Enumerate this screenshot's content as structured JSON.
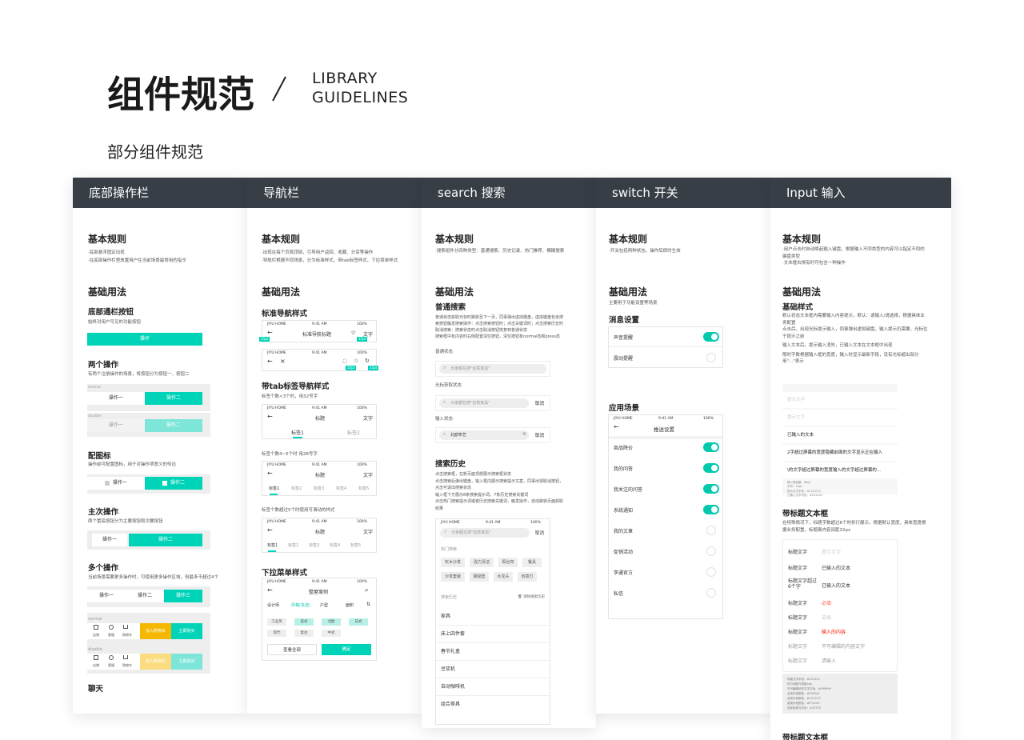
{
  "header": {
    "title": "组件规范",
    "lib1": "LIBRARY",
    "lib2": "GUIDELINES",
    "subtitle": "部分组件规范"
  },
  "p1": {
    "head": "底部操作栏",
    "rules": "基本规则",
    "r1": "·底部悬浮固定出现",
    "r2": "·在底部操作栏里放置用户在当前场景最常用的指令",
    "usage": "基础用法",
    "s1": "底部通栏按钮",
    "s1d": "始终对用户可见的功能按钮",
    "s1b": "操作",
    "s2": "两个操作",
    "s2d": "有两个注册操作的场景，将按钮分为按钮一、按钮二",
    "normal": "normal",
    "disable": "disable",
    "op1": "操作一",
    "op2": "操作二",
    "op3": "操作三",
    "s3": "配图标",
    "s3d": "操作前可配置图标，用于对操作项意义的传达",
    "s4": "主次操作",
    "s4d": "两个置底按钮分为主要按钮和次要按钮",
    "s5": "多个操作",
    "s5d": "当前场景需要更多操作时，可使用更多操作区域，但最多不超过4个",
    "ic1": "店铺",
    "ic2": "客服",
    "ic3": "购物车",
    "cart": "加入购物车",
    "buy": "立即购买",
    "chat": "聊天"
  },
  "p2": {
    "head": "导航栏",
    "rules": "基本规则",
    "r1": "·出现在每个页面顶部，引导用户返回、收藏、分享等操作",
    "r2": "·导航栏根据不同场景，分为标准样式、带tab标签样式、下拉菜单样式",
    "usage": "基础用法",
    "s1": "标准导航样式",
    "carrier": "JIYU HOME",
    "time": "9:41 AM",
    "batt": "100%",
    "navtitle": "标准导航标题",
    "text": "文字",
    "t15": "15pt",
    "s2": "带tab标签导航样式",
    "s2d": "标签个数<3个时，用32号字",
    "title": "标题",
    "tag1": "标签1",
    "tag2": "标签2",
    "tag3": "标签3",
    "tag4": "标签4",
    "tag5": "标签5",
    "s2e": "标签个数4~5个时 用28号字",
    "s2f": "标签个数超过5个时使用可滑动的样式",
    "s3": "下拉菜单样式",
    "cases": "整屋案例",
    "f1": "设计师",
    "f2": "风格(多选)",
    "f3": "户型",
    "f4": "面积",
    "o1": "工业风",
    "o2": "美式",
    "o3": "北欧",
    "o4": "日式",
    "o5": "现代",
    "o6": "复古",
    "o7": "中式",
    "all": "查看全部",
    "ok": "确定"
  },
  "p3": {
    "head": "search 搜索",
    "rules": "基本规则",
    "r1": "·搜索组件分四种类型：普通搜索、历史记录、热门推荐、模糊搜索",
    "usage": "基础用法",
    "s1": "普通搜索",
    "d1": "普通状态获取光标时跳转至下一页，同事弹出虚拟键盘，虚拟键盘包含搜",
    "d2": "索按钮触发搜索操作：点击搜索按钮时；点击关键词时；点击搜索历史时",
    "d3": "取消搜索：搜索状态时点击取消按钮恢复到普通状态",
    "d4": "搜索框中有内容时右侧配置清空按钮，清空按钮有normal态和press态",
    "st1": "普通状态",
    "ph": "大家都在搜\"创意家具\"",
    "st2": "光标获取状态",
    "cancel": "取消",
    "st3": "输入状态",
    "input": "北欧布艺",
    "s2": "搜索历史",
    "e1": "点击搜索框，在新页面顶部展示搜索框状态",
    "e2": "点击搜索后弹出键盘，输入框内展示搜索提示文案，同事出现取消按钮，",
    "e3": "点击可退出搜索状态",
    "e4": "输入框下方展示8条搜索提示词，7条历史搜索关键词",
    "e5": "点击热门搜索提示词或者历史搜索关键词，触发操作，自动跳转页面获取",
    "e6": "结果",
    "carrier": "JIYU HOME",
    "time": "9:41 AM",
    "batt": "100%",
    "hot": "热门搜索",
    "h1": "实木沙发",
    "h2": "强力清洁",
    "h3": "阳台帘",
    "h4": "餐具",
    "h5": "沙发套装",
    "h6": "飘窗垫",
    "h7": "水龙头",
    "h8": "创意灯",
    "hist": "搜索历史",
    "clear": "清除搜索历史",
    "l1": "家具",
    "l2": "床上四件套",
    "l3": "春节礼盒",
    "l4": "豆浆机",
    "l5": "自动咖啡机",
    "l6": "组合茶具"
  },
  "p4": {
    "head": "switch 开关",
    "rules": "基本规则",
    "r1": "·开关包括两种状态，操作后即时生效",
    "usage": "基础用法",
    "ud": "主要用于功能设置等场景",
    "s1": "消息设置",
    "m1": "声音提醒",
    "m2": "震动提醒",
    "s2": "应用场景",
    "carrier": "JIYU HOME",
    "time": "9:41 AM",
    "batt": "100%",
    "ptitle": "推送设置",
    "i1": "商品降价",
    "i2": "我的问答",
    "i3": "我关注的问答",
    "i4": "系统通知",
    "i5": "我的文章",
    "i6": "促销活动",
    "i7": "李通官方",
    "i8": "私信"
  },
  "p5": {
    "head": "Input 输入",
    "rules": "基本规则",
    "r1": "·用户点击时自动唤起输入键盘，根据输入不同类型的内容可以指定不同的",
    "r1b": "键盘类型",
    "r2": "·文本框右侧有时可包含一种操作",
    "usage": "基础用法",
    "s1": "基础样式",
    "d1": "默认状态文本框内需要输入内容提示，默认：请输入/请选择，根据具体业",
    "d1b": "务配置",
    "d2": "点击后，出现光标提示输入，同事弹出虚拟键盘，输入提示仍需要，光标位",
    "d2b": "于提示之前",
    "d3": "输入文本后，提示输入消失，已输入文本在文本框中出现",
    "d4": "限时字数根据输入框的宽度，输入时显示最新字段，没有光标超出部分",
    "d4b": "用\"...\"表示",
    "hint": "提示文字",
    "typed": "已输入的文本",
    "long1": "2字超过屏幕的宽度隐藏前面的文字显示正在输入",
    "long2": "\\的文字超过屏幕的宽度输入的文字超过屏幕的...",
    "spec1": "输入框高度：88pt",
    "spec2": "字号：16pt",
    "spec3": "提示文字字色：#CCCCCC",
    "spec4": "已输入文字字色：#222222",
    "s2": "带标题文本框",
    "e1": "在特殊情况下，标题字数超过6个时折行展示。根据默认宽度，具体宽度根",
    "e2": "据业务配置，标题离内容间距32px",
    "lbl": "标题文字",
    "lbl6a": "标题文字超过",
    "lbl6b": "6个字",
    "req": "必填",
    "sel": "选填",
    "typed2": "输入的内容",
    "noedit": "不可编辑的内容文字",
    "input": "请输入",
    "c1": "标题文字字色：#222222",
    "c2": "折行间距行间距4px",
    "c3": "不可编辑状态文字字色：#999999",
    "c4": "必填字段颜色：#FF604C",
    "c5": "选填字段颜色：#CCCCCC",
    "c6": "错误字段颜色：#FF1C00",
    "c7": "选择类单元字色：#33333",
    "s3": "带标题文本框"
  }
}
